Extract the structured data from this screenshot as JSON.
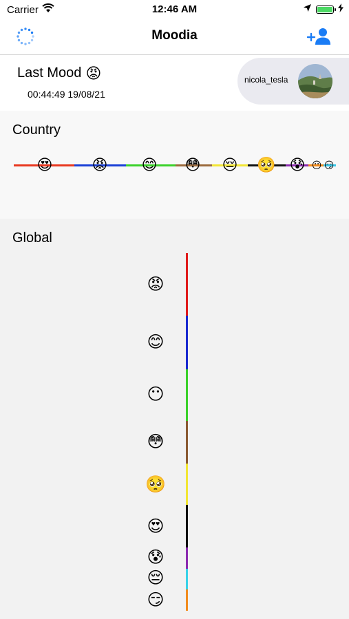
{
  "status_bar": {
    "carrier": "Carrier",
    "time": "12:46 AM",
    "battery_level": 1.0
  },
  "navbar": {
    "title": "Moodia",
    "left_icon": "loading-spinner-icon",
    "right_icon": "add-user-icon",
    "accent_color": "#1a7cf5"
  },
  "last_mood": {
    "title": "Last Mood",
    "emoji": "😡",
    "timestamp": "00:44:49 19/08/21"
  },
  "user": {
    "username": "nicola_tesla"
  },
  "country": {
    "title": "Country",
    "moods": [
      {
        "emoji": "😍",
        "color": "#e8371f"
      },
      {
        "emoji": "😡",
        "color": "#1a3fd6"
      },
      {
        "emoji": "😊",
        "color": "#3ad12a"
      },
      {
        "emoji": "😳",
        "color": "#9b6a3c"
      },
      {
        "emoji": "😔",
        "color": "#f2e634"
      },
      {
        "emoji": "🥺",
        "color": "#111111"
      },
      {
        "emoji": "😰",
        "color": "#8c2bb0"
      },
      {
        "emoji": "😶",
        "color": "#f28c1e"
      },
      {
        "emoji": "😏",
        "color": "#38c7e8"
      }
    ]
  },
  "global": {
    "title": "Global",
    "moods": [
      {
        "emoji": "😡",
        "color": "#e01b1b"
      },
      {
        "emoji": "😊",
        "color": "#1a2ad0"
      },
      {
        "emoji": "😶",
        "color": "#3ad12a"
      },
      {
        "emoji": "😳",
        "color": "#8a5a32"
      },
      {
        "emoji": "🥺",
        "color": "#f2e634"
      },
      {
        "emoji": "😍",
        "color": "#111111"
      },
      {
        "emoji": "😰",
        "color": "#8c2bb0"
      },
      {
        "emoji": "😔",
        "color": "#38d2e8"
      },
      {
        "emoji": "😏",
        "color": "#f28c1e"
      }
    ]
  }
}
